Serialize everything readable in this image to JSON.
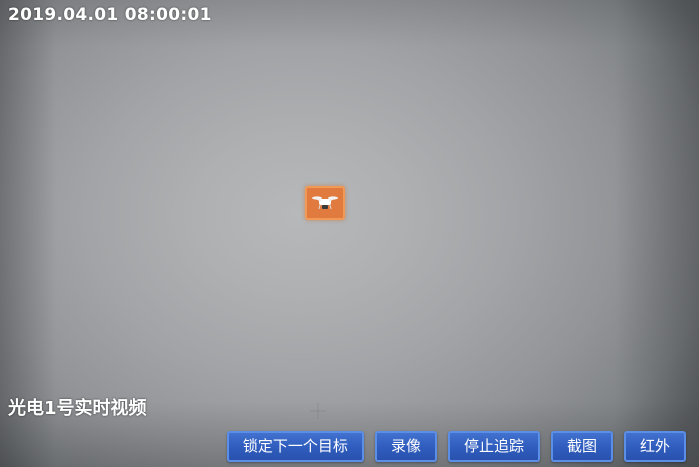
{
  "video": {
    "timestamp": "2019.04.01 08:00:01",
    "camera_label": "光电1号实时视频"
  },
  "target": {
    "icon": "drone-icon",
    "box_color": "#e07a3e"
  },
  "toolbar": {
    "lock_next_target": "锁定下一个目标",
    "record": "录像",
    "stop_tracking": "停止追踪",
    "screenshot": "截图",
    "infrared": "红外"
  },
  "colors": {
    "button_bg": "#2f5cbd",
    "button_border": "#5b8ee6",
    "overlay_text": "#ffffff"
  }
}
